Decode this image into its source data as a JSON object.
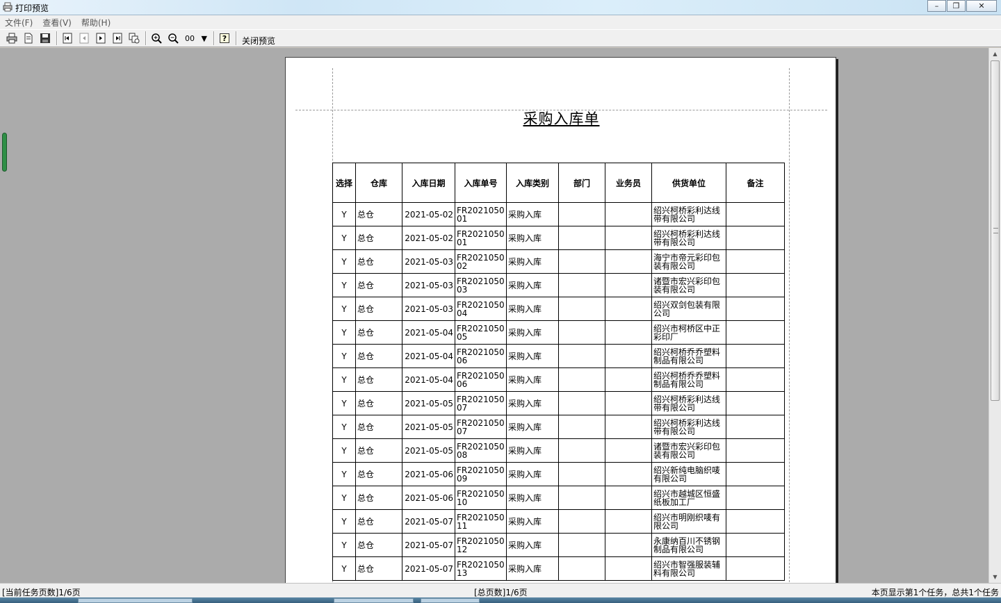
{
  "window": {
    "title": "打印预览"
  },
  "menu": [
    "文件(F)",
    "查看(V)",
    "帮助(H)"
  ],
  "toolbar": {
    "zoom_value": "00",
    "close_preview_label": "关闭预览"
  },
  "document": {
    "title": "采购入库单",
    "headers": [
      "选择",
      "仓库",
      "入库日期",
      "入库单号",
      "入库类别",
      "部门",
      "业务员",
      "供货单位",
      "备注"
    ],
    "rows": [
      [
        "Y",
        "总仓",
        "2021-05-02",
        "FR202105001",
        "采购入库",
        "",
        "",
        "绍兴柯桥彩利达线带有限公司",
        ""
      ],
      [
        "Y",
        "总仓",
        "2021-05-02",
        "FR202105001",
        "采购入库",
        "",
        "",
        "绍兴柯桥彩利达线带有限公司",
        ""
      ],
      [
        "Y",
        "总仓",
        "2021-05-03",
        "FR202105002",
        "采购入库",
        "",
        "",
        "海宁市帝元彩印包装有限公司",
        ""
      ],
      [
        "Y",
        "总仓",
        "2021-05-03",
        "FR202105003",
        "采购入库",
        "",
        "",
        "诸暨市宏兴彩印包装有限公司",
        ""
      ],
      [
        "Y",
        "总仓",
        "2021-05-03",
        "FR202105004",
        "采购入库",
        "",
        "",
        "绍兴双剑包装有限公司",
        ""
      ],
      [
        "Y",
        "总仓",
        "2021-05-04",
        "FR202105005",
        "采购入库",
        "",
        "",
        "绍兴市柯桥区中正彩印厂",
        ""
      ],
      [
        "Y",
        "总仓",
        "2021-05-04",
        "FR202105006",
        "采购入库",
        "",
        "",
        "绍兴柯桥乔乔塑料制品有限公司",
        ""
      ],
      [
        "Y",
        "总仓",
        "2021-05-04",
        "FR202105006",
        "采购入库",
        "",
        "",
        "绍兴柯桥乔乔塑料制品有限公司",
        ""
      ],
      [
        "Y",
        "总仓",
        "2021-05-05",
        "FR202105007",
        "采购入库",
        "",
        "",
        "绍兴柯桥彩利达线带有限公司",
        ""
      ],
      [
        "Y",
        "总仓",
        "2021-05-05",
        "FR202105007",
        "采购入库",
        "",
        "",
        "绍兴柯桥彩利达线带有限公司",
        ""
      ],
      [
        "Y",
        "总仓",
        "2021-05-05",
        "FR202105008",
        "采购入库",
        "",
        "",
        "诸暨市宏兴彩印包装有限公司",
        ""
      ],
      [
        "Y",
        "总仓",
        "2021-05-06",
        "FR202105009",
        "采购入库",
        "",
        "",
        "绍兴新纯电脑织唛有限公司",
        ""
      ],
      [
        "Y",
        "总仓",
        "2021-05-06",
        "FR202105010",
        "采购入库",
        "",
        "",
        "绍兴市越城区恒盛纸板加工厂",
        ""
      ],
      [
        "Y",
        "总仓",
        "2021-05-07",
        "FR202105011",
        "采购入库",
        "",
        "",
        "绍兴市明刚织唛有限公司",
        ""
      ],
      [
        "Y",
        "总仓",
        "2021-05-07",
        "FR202105012",
        "采购入库",
        "",
        "",
        "永康纳百川不锈钢制品有限公司",
        ""
      ],
      [
        "Y",
        "总仓",
        "2021-05-07",
        "FR202105013",
        "采购入库",
        "",
        "",
        "绍兴市智强服装辅料有限公司",
        ""
      ]
    ]
  },
  "status": {
    "current_page": "[当前任务页数]1/6页",
    "total_pages": "[总页数]1/6页",
    "summary": "本页显示第1个任务，总共1个任务"
  }
}
